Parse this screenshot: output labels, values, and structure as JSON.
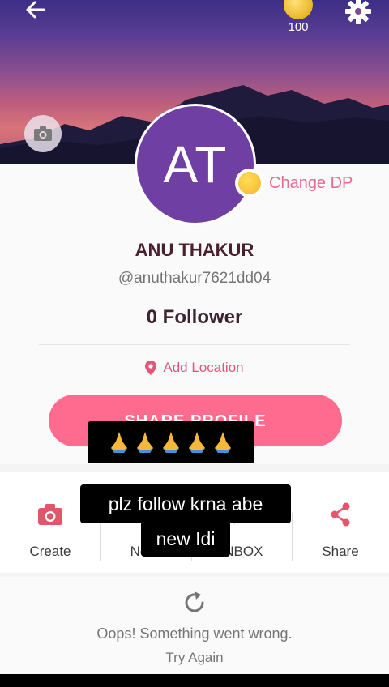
{
  "header": {
    "coin_count": "100",
    "back_icon": "arrow-left-icon",
    "coin_icon": "coin-icon",
    "settings_icon": "gear-icon"
  },
  "profile": {
    "initials": "AT",
    "change_dp_label": "Change DP",
    "name": "ANU THAKUR",
    "handle": "@anuthakur7621dd04",
    "followers": "0 Follower",
    "location_label": "Add Location",
    "share_profile_label": "SHARE PROFILE",
    "avatar_color": "#6f3fa3",
    "accent_color": "#ff6b8f"
  },
  "actions": [
    {
      "label": "Create",
      "icon": "camera-icon"
    },
    {
      "label": "Notifi",
      "icon": "bell-icon"
    },
    {
      "label": "INBOX",
      "icon": "chat-icon"
    },
    {
      "label": "Share",
      "icon": "share-icon"
    }
  ],
  "error": {
    "message": "Oops! Something went wrong.",
    "retry_label": "Try Again"
  },
  "captions": {
    "emoji_row": "🙏🙏🙏🙏🙏",
    "line1": "plz follow krna abe",
    "line2": "new Idi"
  }
}
